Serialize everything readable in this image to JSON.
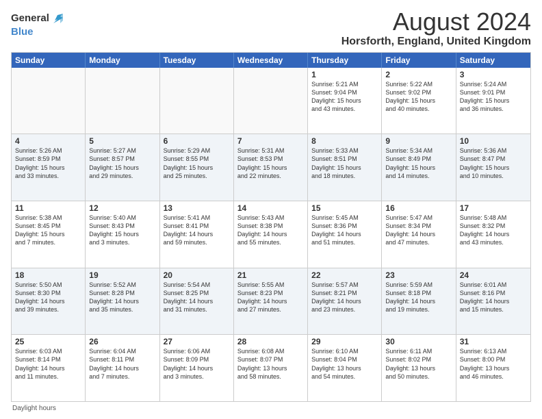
{
  "logo": {
    "text_general": "General",
    "text_blue": "Blue"
  },
  "title": "August 2024",
  "subtitle": "Horsforth, England, United Kingdom",
  "footer_note": "Daylight hours",
  "headers": [
    "Sunday",
    "Monday",
    "Tuesday",
    "Wednesday",
    "Thursday",
    "Friday",
    "Saturday"
  ],
  "rows": [
    [
      {
        "day": "",
        "detail": ""
      },
      {
        "day": "",
        "detail": ""
      },
      {
        "day": "",
        "detail": ""
      },
      {
        "day": "",
        "detail": ""
      },
      {
        "day": "1",
        "detail": "Sunrise: 5:21 AM\nSunset: 9:04 PM\nDaylight: 15 hours\nand 43 minutes."
      },
      {
        "day": "2",
        "detail": "Sunrise: 5:22 AM\nSunset: 9:02 PM\nDaylight: 15 hours\nand 40 minutes."
      },
      {
        "day": "3",
        "detail": "Sunrise: 5:24 AM\nSunset: 9:01 PM\nDaylight: 15 hours\nand 36 minutes."
      }
    ],
    [
      {
        "day": "4",
        "detail": "Sunrise: 5:26 AM\nSunset: 8:59 PM\nDaylight: 15 hours\nand 33 minutes."
      },
      {
        "day": "5",
        "detail": "Sunrise: 5:27 AM\nSunset: 8:57 PM\nDaylight: 15 hours\nand 29 minutes."
      },
      {
        "day": "6",
        "detail": "Sunrise: 5:29 AM\nSunset: 8:55 PM\nDaylight: 15 hours\nand 25 minutes."
      },
      {
        "day": "7",
        "detail": "Sunrise: 5:31 AM\nSunset: 8:53 PM\nDaylight: 15 hours\nand 22 minutes."
      },
      {
        "day": "8",
        "detail": "Sunrise: 5:33 AM\nSunset: 8:51 PM\nDaylight: 15 hours\nand 18 minutes."
      },
      {
        "day": "9",
        "detail": "Sunrise: 5:34 AM\nSunset: 8:49 PM\nDaylight: 15 hours\nand 14 minutes."
      },
      {
        "day": "10",
        "detail": "Sunrise: 5:36 AM\nSunset: 8:47 PM\nDaylight: 15 hours\nand 10 minutes."
      }
    ],
    [
      {
        "day": "11",
        "detail": "Sunrise: 5:38 AM\nSunset: 8:45 PM\nDaylight: 15 hours\nand 7 minutes."
      },
      {
        "day": "12",
        "detail": "Sunrise: 5:40 AM\nSunset: 8:43 PM\nDaylight: 15 hours\nand 3 minutes."
      },
      {
        "day": "13",
        "detail": "Sunrise: 5:41 AM\nSunset: 8:41 PM\nDaylight: 14 hours\nand 59 minutes."
      },
      {
        "day": "14",
        "detail": "Sunrise: 5:43 AM\nSunset: 8:38 PM\nDaylight: 14 hours\nand 55 minutes."
      },
      {
        "day": "15",
        "detail": "Sunrise: 5:45 AM\nSunset: 8:36 PM\nDaylight: 14 hours\nand 51 minutes."
      },
      {
        "day": "16",
        "detail": "Sunrise: 5:47 AM\nSunset: 8:34 PM\nDaylight: 14 hours\nand 47 minutes."
      },
      {
        "day": "17",
        "detail": "Sunrise: 5:48 AM\nSunset: 8:32 PM\nDaylight: 14 hours\nand 43 minutes."
      }
    ],
    [
      {
        "day": "18",
        "detail": "Sunrise: 5:50 AM\nSunset: 8:30 PM\nDaylight: 14 hours\nand 39 minutes."
      },
      {
        "day": "19",
        "detail": "Sunrise: 5:52 AM\nSunset: 8:28 PM\nDaylight: 14 hours\nand 35 minutes."
      },
      {
        "day": "20",
        "detail": "Sunrise: 5:54 AM\nSunset: 8:25 PM\nDaylight: 14 hours\nand 31 minutes."
      },
      {
        "day": "21",
        "detail": "Sunrise: 5:55 AM\nSunset: 8:23 PM\nDaylight: 14 hours\nand 27 minutes."
      },
      {
        "day": "22",
        "detail": "Sunrise: 5:57 AM\nSunset: 8:21 PM\nDaylight: 14 hours\nand 23 minutes."
      },
      {
        "day": "23",
        "detail": "Sunrise: 5:59 AM\nSunset: 8:18 PM\nDaylight: 14 hours\nand 19 minutes."
      },
      {
        "day": "24",
        "detail": "Sunrise: 6:01 AM\nSunset: 8:16 PM\nDaylight: 14 hours\nand 15 minutes."
      }
    ],
    [
      {
        "day": "25",
        "detail": "Sunrise: 6:03 AM\nSunset: 8:14 PM\nDaylight: 14 hours\nand 11 minutes."
      },
      {
        "day": "26",
        "detail": "Sunrise: 6:04 AM\nSunset: 8:11 PM\nDaylight: 14 hours\nand 7 minutes."
      },
      {
        "day": "27",
        "detail": "Sunrise: 6:06 AM\nSunset: 8:09 PM\nDaylight: 14 hours\nand 3 minutes."
      },
      {
        "day": "28",
        "detail": "Sunrise: 6:08 AM\nSunset: 8:07 PM\nDaylight: 13 hours\nand 58 minutes."
      },
      {
        "day": "29",
        "detail": "Sunrise: 6:10 AM\nSunset: 8:04 PM\nDaylight: 13 hours\nand 54 minutes."
      },
      {
        "day": "30",
        "detail": "Sunrise: 6:11 AM\nSunset: 8:02 PM\nDaylight: 13 hours\nand 50 minutes."
      },
      {
        "day": "31",
        "detail": "Sunrise: 6:13 AM\nSunset: 8:00 PM\nDaylight: 13 hours\nand 46 minutes."
      }
    ]
  ]
}
